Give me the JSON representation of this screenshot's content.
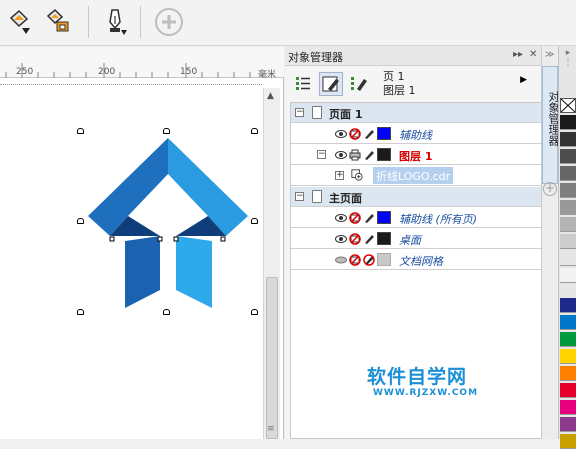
{
  "toolbar": {
    "buttons": [
      "fill-icon",
      "fill-copy-icon",
      "pen-tool-icon",
      "add-icon"
    ]
  },
  "ruler": {
    "ticks": [
      "250",
      "200",
      "150"
    ],
    "unit": "毫米"
  },
  "logo": {
    "colors": {
      "dark_blue": "#1b63b0",
      "mid_blue": "#1f86d4",
      "light_blue": "#2ea9ec",
      "navy": "#0f3e7a"
    }
  },
  "panel": {
    "title": "对象管理器",
    "page_label": "页 1",
    "layer_label": "图层 1",
    "tree": {
      "page1_label": "页面 1",
      "guides_label": "辅助线",
      "layer1_label": "图层 1",
      "object_label": "折线LOGO.cdr",
      "master_label": "主页面",
      "guides_all_label": "辅助线 (所有页)",
      "desktop_label": "桌面",
      "grid_label": "文档网格"
    },
    "colors": {
      "guides_swatch": "#0000ff",
      "layer_swatch": "#1a1a1a",
      "desktop_swatch": "#1a1a1a",
      "grid_swatch": "#c8c8c8",
      "layer_text": "#d40000",
      "link_text": "#1a4fa0"
    }
  },
  "side_tab": {
    "label": "对象管理器"
  },
  "palette": {
    "colors": [
      "#ffffff",
      "#1a1a1a",
      "#333333",
      "#4d4d4d",
      "#666666",
      "#7f7f7f",
      "#999999",
      "#b3b3b3",
      "#cccccc",
      "#e6e6e6",
      "#f2f2f2",
      "#1f2a8a",
      "#0077c8",
      "#009a3e",
      "#ffd400",
      "#ff7f00",
      "#e4002b",
      "#e6007e",
      "#8e3b8e",
      "#c8a000"
    ]
  },
  "watermark": {
    "main": "软件自学网",
    "sub": "WWW.RJZXW.COM"
  }
}
